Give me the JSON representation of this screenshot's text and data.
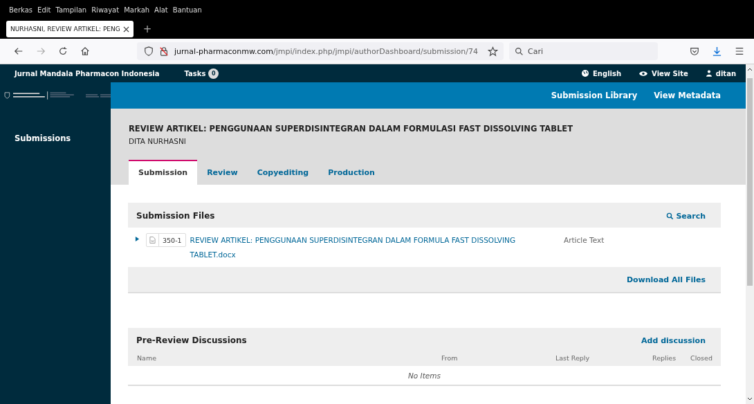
{
  "browser": {
    "menu": [
      "Berkas",
      "Edit",
      "Tampilan",
      "Riwayat",
      "Markah",
      "Alat",
      "Bantuan"
    ],
    "tabs": [
      {
        "title": "NURHASNI, REVIEW ARTIKEL: PENG",
        "selected": true
      }
    ],
    "new_tab": "+",
    "url": {
      "domain": "jurnal-pharmaconmw.com",
      "path": "/jmpi/index.php/jmpi/authorDashboard/submission/74"
    },
    "search": {
      "placeholder": "Cari"
    }
  },
  "header": {
    "site": "Jurnal Mandala Pharmacon Indonesia",
    "tasks_label": "Tasks",
    "tasks_count": "0",
    "language": "English",
    "view_site": "View Site",
    "user": "ditan"
  },
  "sidebar": {
    "items": [
      {
        "label": "Submissions",
        "selected": true
      }
    ]
  },
  "topbar": {
    "links": [
      "Submission Library",
      "View Metadata"
    ]
  },
  "submission": {
    "title": "REVIEW ARTIKEL: PENGGUNAAN SUPERDISINTEGRAN DALAM FORMULASI FAST DISSOLVING TABLET",
    "author": "DITA NURHASNI"
  },
  "tabs": [
    {
      "label": "Submission",
      "selected": true
    },
    {
      "label": "Review",
      "selected": false
    },
    {
      "label": "Copyediting",
      "selected": false
    },
    {
      "label": "Production",
      "selected": false
    }
  ],
  "files_panel": {
    "title": "Submission Files",
    "search": "Search",
    "files": [
      {
        "id": "350-1",
        "name": "REVIEW ARTIKEL: PENGGUNAAN SUPERDISINTEGRAN DALAM FORMULA FAST DISSOLVING TABLET.docx",
        "type": "Article Text",
        "expanded": false
      }
    ],
    "download_all": "Download All Files"
  },
  "discussions": {
    "title": "Pre-Review Discussions",
    "add": "Add discussion",
    "columns": [
      "Name",
      "From",
      "Last Reply",
      "Replies",
      "Closed"
    ],
    "empty": "No Items"
  }
}
